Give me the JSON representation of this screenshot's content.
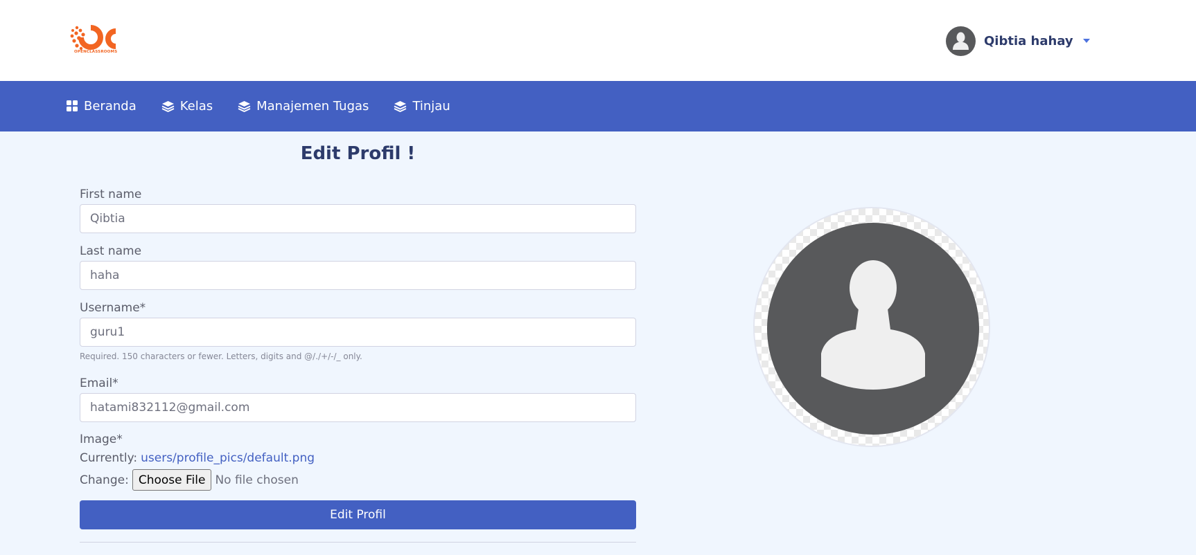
{
  "brand": {
    "logo_text": "OC",
    "logo_caption": "OPENCLASSROOMS",
    "color": "#f26522"
  },
  "user": {
    "name": "Qibtia hahay"
  },
  "nav": {
    "items": [
      {
        "label": "Beranda",
        "icon": "dashboard-icon"
      },
      {
        "label": "Kelas",
        "icon": "layers-icon"
      },
      {
        "label": "Manajemen Tugas",
        "icon": "layers-icon"
      },
      {
        "label": "Tinjau",
        "icon": "layers-icon"
      }
    ]
  },
  "form": {
    "title": "Edit Profil !",
    "first_name": {
      "label": "First name",
      "value": "Qibtia"
    },
    "last_name": {
      "label": "Last name",
      "value": "haha"
    },
    "username": {
      "label": "Username*",
      "value": "guru1",
      "help": "Required. 150 characters or fewer. Letters, digits and @/./+/-/_ only."
    },
    "email": {
      "label": "Email*",
      "value": "hatami832112@gmail.com"
    },
    "image": {
      "label": "Image*",
      "currently_label": "Currently:",
      "currently_value": "users/profile_pics/default.png",
      "change_label": "Change:",
      "choose_button": "Choose File",
      "file_status": "No file chosen"
    },
    "submit_label": "Edit Profil"
  },
  "colors": {
    "primary": "#4360c2",
    "title": "#2d3b6b",
    "background": "#f0f6fe"
  }
}
